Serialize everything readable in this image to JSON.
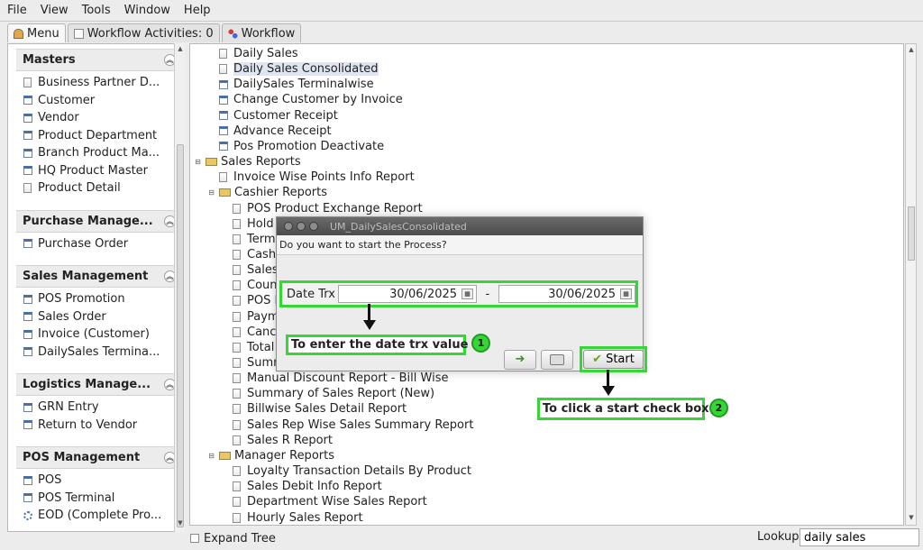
{
  "menubar": {
    "items": [
      "File",
      "View",
      "Tools",
      "Window",
      "Help"
    ]
  },
  "tabs": [
    {
      "label": "Menu",
      "icon": "home-icon"
    },
    {
      "label": "Workflow Activities: 0",
      "icon": "activity-icon"
    },
    {
      "label": "Workflow",
      "icon": "workflow-icon"
    }
  ],
  "sidebar": {
    "sections": [
      {
        "title": "Masters",
        "items": [
          "Business Partner D...",
          "Customer",
          "Vendor",
          "Product Department",
          "Branch Product Ma...",
          "HQ Product Master",
          "Product Detail"
        ]
      },
      {
        "title": "Purchase Manage...",
        "items": [
          "Purchase Order"
        ]
      },
      {
        "title": "Sales Management",
        "items": [
          "POS Promotion",
          "Sales Order",
          "Invoice (Customer)",
          "DailySales Termina..."
        ]
      },
      {
        "title": "Logistics Manage...",
        "items": [
          "GRN Entry",
          "Return to Vendor"
        ]
      },
      {
        "title": "POS Management",
        "items": [
          "POS",
          "POS Terminal",
          "EOD (Complete Pro..."
        ]
      }
    ]
  },
  "tree": {
    "rows": [
      {
        "label": "Daily Sales",
        "level": 2,
        "type": "doc"
      },
      {
        "label": "Daily Sales Consolidated",
        "level": 2,
        "type": "doc",
        "selected": true
      },
      {
        "label": "DailySales Terminalwise",
        "level": 2,
        "type": "win"
      },
      {
        "label": "Change Customer by Invoice",
        "level": 2,
        "type": "win"
      },
      {
        "label": "Customer Receipt",
        "level": 2,
        "type": "win"
      },
      {
        "label": "Advance Receipt",
        "level": 2,
        "type": "win"
      },
      {
        "label": "Pos Promotion Deactivate",
        "level": 2,
        "type": "win"
      },
      {
        "label": "Sales Reports",
        "level": 1,
        "type": "folder"
      },
      {
        "label": "Invoice Wise Points Info Report",
        "level": 2,
        "type": "doc"
      },
      {
        "label": "Cashier Reports",
        "level": 2,
        "type": "folder"
      },
      {
        "label": "POS Product Exchange Report",
        "level": 3,
        "type": "doc"
      },
      {
        "label": "Hold B",
        "level": 3,
        "type": "doc"
      },
      {
        "label": "Termi",
        "level": 3,
        "type": "doc"
      },
      {
        "label": "Cashi",
        "level": 3,
        "type": "doc"
      },
      {
        "label": "Sales",
        "level": 3,
        "type": "doc"
      },
      {
        "label": "Count",
        "level": 3,
        "type": "doc"
      },
      {
        "label": "POS P",
        "level": 3,
        "type": "doc"
      },
      {
        "label": "Payme",
        "level": 3,
        "type": "doc"
      },
      {
        "label": "Cance",
        "level": 3,
        "type": "doc"
      },
      {
        "label": "Total S",
        "level": 3,
        "type": "doc"
      },
      {
        "label": "Summ",
        "level": 3,
        "type": "doc"
      },
      {
        "label": "Manual Discount Report - Bill Wise",
        "level": 3,
        "type": "doc"
      },
      {
        "label": "Summary of Sales Report (New)",
        "level": 3,
        "type": "doc"
      },
      {
        "label": "Billwise Sales Detail Report",
        "level": 3,
        "type": "doc"
      },
      {
        "label": "Sales Rep Wise Sales Summary Report",
        "level": 3,
        "type": "doc"
      },
      {
        "label": "Sales R Report",
        "level": 3,
        "type": "doc"
      },
      {
        "label": "Manager Reports",
        "level": 2,
        "type": "folder"
      },
      {
        "label": "Loyalty Transaction Details By Product",
        "level": 3,
        "type": "doc"
      },
      {
        "label": "Sales Debit Info Report",
        "level": 3,
        "type": "doc"
      },
      {
        "label": "Department Wise Sales Report",
        "level": 3,
        "type": "doc"
      },
      {
        "label": "Hourly Sales Report",
        "level": 3,
        "type": "doc"
      }
    ]
  },
  "bottom": {
    "expand_tree_label": "Expand Tree",
    "lookup_label": "Lookup",
    "lookup_value": "daily sales"
  },
  "dialog": {
    "title": "UM_DailySalesConsolidated",
    "question": "Do you want to start the Process?",
    "date_label": "Date Trx",
    "date_from": "30/06/2025",
    "date_to": "30/06/2025",
    "separator": "-",
    "start_label": "Start"
  },
  "annotations": {
    "callout1": "To enter the date trx value",
    "callout2": "To click a start check box",
    "badge1": "1",
    "badge2": "2",
    "highlight_color": "#35d635"
  }
}
